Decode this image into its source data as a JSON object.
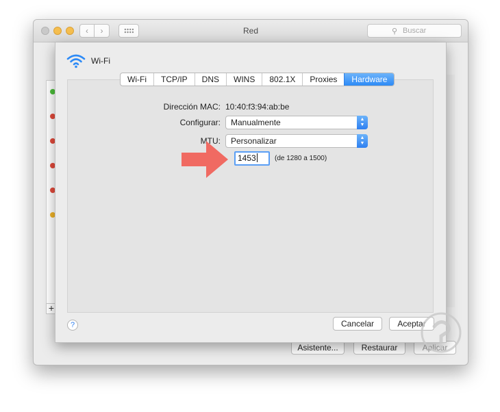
{
  "window": {
    "title": "Red",
    "search_placeholder": "Buscar",
    "nav_back_icon": "chevron-left-icon",
    "nav_forward_icon": "chevron-right-icon",
    "grid_icon": "grid-icon",
    "sidebar_status_colors": [
      "#4cbf3a",
      "#e34b3c",
      "#e34b3c",
      "#e34b3c",
      "#e34b3c",
      "#f0b429"
    ],
    "add_button_label": "+",
    "bottom_buttons": {
      "assistant": "Asistente...",
      "revert": "Restaurar",
      "apply": "Aplicar"
    }
  },
  "sheet": {
    "interface_name": "Wi-Fi",
    "tabs": [
      "Wi-Fi",
      "TCP/IP",
      "DNS",
      "WINS",
      "802.1X",
      "Proxies",
      "Hardware"
    ],
    "active_tab": "Hardware",
    "mac_label": "Dirección MAC:",
    "mac_value": "10:40:f3:94:ab:be",
    "configure_label": "Configurar:",
    "configure_value": "Manualmente",
    "mtu_label": "MTU:",
    "mtu_value": "Personalizar",
    "mtu_custom_value": "1453",
    "mtu_range_note": "(de 1280 a 1500)",
    "help_label": "?",
    "cancel_label": "Cancelar",
    "ok_label": "Aceptar"
  },
  "colors": {
    "accent": "#2d8af6",
    "annotation_arrow": "#f06a62"
  }
}
